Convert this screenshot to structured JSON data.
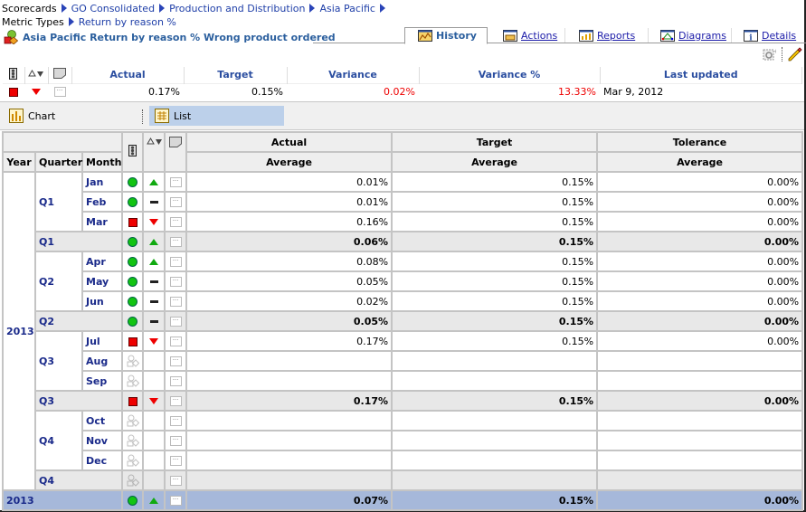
{
  "breadcrumb": {
    "line1": [
      "Scorecards",
      "GO Consolidated",
      "Production and Distribution",
      "Asia Pacific"
    ],
    "line2": [
      "Metric Types",
      "Return by reason %"
    ]
  },
  "page_title": "Asia Pacific Return by reason % Wrong product ordered",
  "tabs": [
    {
      "label": "History",
      "icon": "history-chart-icon",
      "active": true
    },
    {
      "label": "Actions",
      "icon": "actions-icon",
      "active": false
    },
    {
      "label": "Reports",
      "icon": "reports-icon",
      "active": false
    },
    {
      "label": "Diagrams",
      "icon": "diagrams-icon",
      "active": false
    },
    {
      "label": "Details",
      "icon": "details-info-icon",
      "active": false
    }
  ],
  "toolbar": {
    "icons": [
      "watch-settings-icon",
      "edit-pencil-icon"
    ]
  },
  "summary": {
    "headers": [
      "Actual",
      "Target",
      "Variance",
      "Variance %",
      "Last updated"
    ],
    "status": "red-square",
    "trend": "down",
    "actual": "0.17%",
    "target": "0.15%",
    "variance": "0.02%",
    "variance_pct": "13.33%",
    "last_updated": "Mar 9, 2012"
  },
  "view": {
    "chart_label": "Chart",
    "list_label": "List",
    "selected": "List"
  },
  "grid": {
    "col_groups": [
      "Actual",
      "Target",
      "Tolerance"
    ],
    "sub_header": "Average",
    "dim_headers": [
      "Year",
      "Quarter",
      "Month"
    ],
    "year": "2013",
    "rows": [
      {
        "type": "month",
        "quarter": "Q1",
        "month": "Jan",
        "status": "green",
        "trend": "up",
        "actual": "0.01%",
        "target": "0.15%",
        "tolerance": "0.00%"
      },
      {
        "type": "month",
        "quarter": "Q1",
        "month": "Feb",
        "status": "green",
        "trend": "flat",
        "actual": "0.01%",
        "target": "0.15%",
        "tolerance": "0.00%"
      },
      {
        "type": "month",
        "quarter": "Q1",
        "month": "Mar",
        "status": "red",
        "trend": "down",
        "actual": "0.16%",
        "target": "0.15%",
        "tolerance": "0.00%"
      },
      {
        "type": "quarter",
        "quarter": "Q1",
        "status": "green",
        "trend": "up",
        "actual": "0.06%",
        "target": "0.15%",
        "tolerance": "0.00%"
      },
      {
        "type": "month",
        "quarter": "Q2",
        "month": "Apr",
        "status": "green",
        "trend": "up",
        "actual": "0.08%",
        "target": "0.15%",
        "tolerance": "0.00%"
      },
      {
        "type": "month",
        "quarter": "Q2",
        "month": "May",
        "status": "green",
        "trend": "flat",
        "actual": "0.05%",
        "target": "0.15%",
        "tolerance": "0.00%"
      },
      {
        "type": "month",
        "quarter": "Q2",
        "month": "Jun",
        "status": "green",
        "trend": "flat",
        "actual": "0.02%",
        "target": "0.15%",
        "tolerance": "0.00%"
      },
      {
        "type": "quarter",
        "quarter": "Q2",
        "status": "green",
        "trend": "flat",
        "actual": "0.05%",
        "target": "0.15%",
        "tolerance": "0.00%"
      },
      {
        "type": "month",
        "quarter": "Q3",
        "month": "Jul",
        "status": "red",
        "trend": "down",
        "actual": "0.17%",
        "target": "0.15%",
        "tolerance": "0.00%"
      },
      {
        "type": "month",
        "quarter": "Q3",
        "month": "Aug",
        "status": "none",
        "trend": "",
        "actual": "",
        "target": "",
        "tolerance": ""
      },
      {
        "type": "month",
        "quarter": "Q3",
        "month": "Sep",
        "status": "none",
        "trend": "",
        "actual": "",
        "target": "",
        "tolerance": ""
      },
      {
        "type": "quarter",
        "quarter": "Q3",
        "status": "red",
        "trend": "down",
        "actual": "0.17%",
        "target": "0.15%",
        "tolerance": "0.00%"
      },
      {
        "type": "month",
        "quarter": "Q4",
        "month": "Oct",
        "status": "none",
        "trend": "",
        "actual": "",
        "target": "",
        "tolerance": ""
      },
      {
        "type": "month",
        "quarter": "Q4",
        "month": "Nov",
        "status": "none",
        "trend": "",
        "actual": "",
        "target": "",
        "tolerance": ""
      },
      {
        "type": "month",
        "quarter": "Q4",
        "month": "Dec",
        "status": "none",
        "trend": "",
        "actual": "",
        "target": "",
        "tolerance": ""
      },
      {
        "type": "quarter",
        "quarter": "Q4",
        "status": "none",
        "trend": "",
        "actual": "",
        "target": "",
        "tolerance": ""
      }
    ],
    "total": {
      "label": "2013",
      "status": "green",
      "trend": "up",
      "actual": "0.07%",
      "target": "0.15%",
      "tolerance": "0.00%"
    }
  }
}
